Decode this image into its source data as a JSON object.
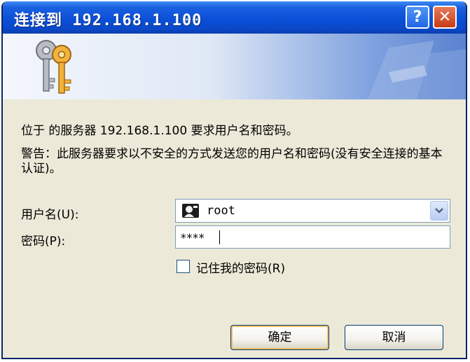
{
  "window": {
    "title": "连接到 192.168.1.100",
    "help_label": "?",
    "close_label": "✕"
  },
  "banner": {
    "icon": "keys-icon"
  },
  "message": "位于  的服务器 192.168.1.100 要求用户名和密码。",
  "warning": "警告：此服务器要求以不安全的方式发送您的用户名和密码(没有安全连接的基本认证)。",
  "form": {
    "username_label": "用户名(U):",
    "username_value": "root",
    "password_label": "密码(P):",
    "password_value": "****",
    "remember_label": "记住我的密码(R)",
    "remember_checked": false
  },
  "buttons": {
    "ok": "确定",
    "cancel": "取消"
  },
  "colors": {
    "titlebar": "#0b4fd8",
    "dialog_bg": "#ece9d8",
    "close_button": "#c73b16"
  }
}
